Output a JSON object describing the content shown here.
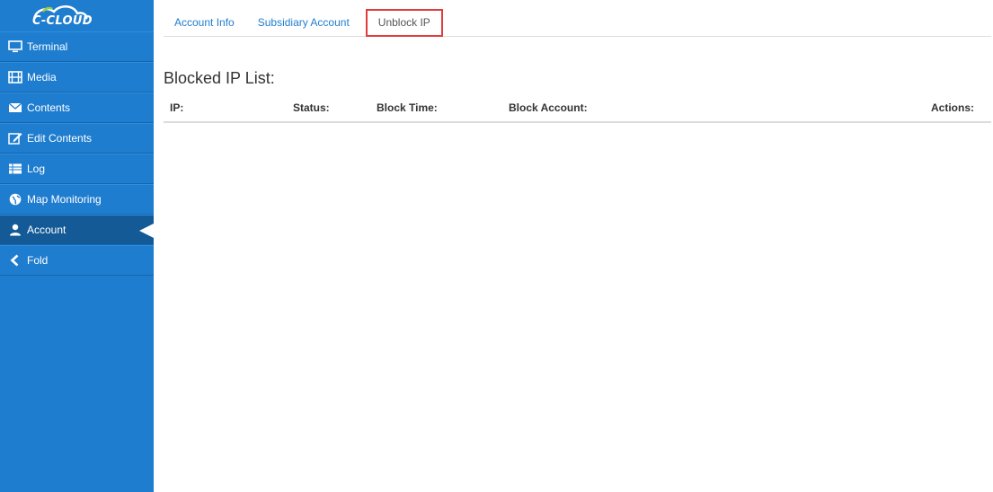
{
  "logo": {
    "text": "C-CLOUD"
  },
  "sidebar": {
    "items": [
      {
        "label": "Terminal",
        "icon": "monitor-icon"
      },
      {
        "label": "Media",
        "icon": "film-icon"
      },
      {
        "label": "Contents",
        "icon": "envelope-icon"
      },
      {
        "label": "Edit Contents",
        "icon": "edit-icon"
      },
      {
        "label": "Log",
        "icon": "list-icon"
      },
      {
        "label": "Map Monitoring",
        "icon": "globe-icon"
      },
      {
        "label": "Account",
        "icon": "user-icon",
        "active": true
      },
      {
        "label": "Fold",
        "icon": "chevron-left-icon"
      }
    ]
  },
  "tabs": [
    {
      "label": "Account Info"
    },
    {
      "label": "Subsidiary Account"
    },
    {
      "label": "Unblock IP",
      "active": true
    }
  ],
  "main": {
    "title": "Blocked IP List:",
    "columns": [
      "IP:",
      "Status:",
      "Block Time:",
      "Block Account:",
      "Actions:"
    ]
  },
  "colors": {
    "sidebar": "#1f7dcf",
    "sidebar_active": "#145a96",
    "tab_link": "#1f7dcf",
    "highlight": "#e03c3c"
  }
}
